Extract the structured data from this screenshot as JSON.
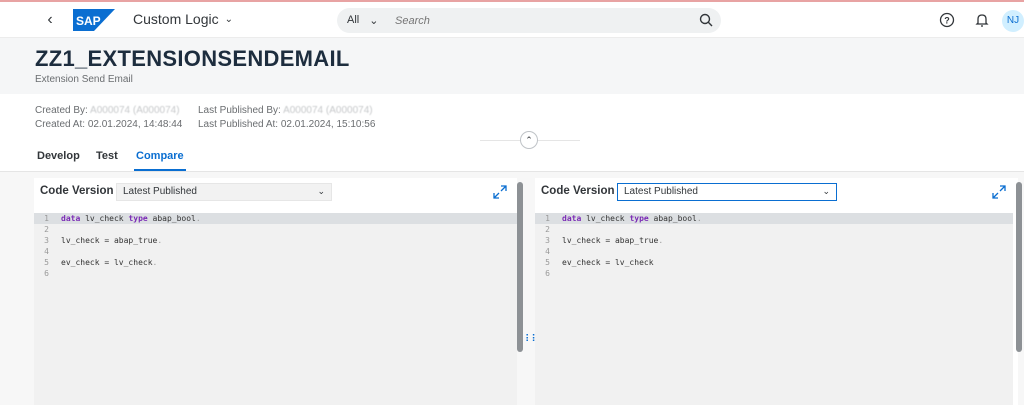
{
  "shell": {
    "app_title": "Custom Logic",
    "search_category": "All",
    "search_placeholder": "Search",
    "avatar_initials": "NJ",
    "brand": "SAP"
  },
  "object": {
    "title": "ZZ1_EXTENSIONSENDEMAIL",
    "subtitle": "Extension Send Email"
  },
  "meta": {
    "created_by_label": "Created By:",
    "created_by_value": "A000074 (A000074)",
    "created_at_label": "Created At:",
    "created_at_value": "02.01.2024, 14:48:44",
    "published_by_label": "Last Published By:",
    "published_by_value": "A000074 (A000074)",
    "published_at_label": "Last Published At:",
    "published_at_value": "02.01.2024, 15:10:56"
  },
  "tabs": {
    "develop": "Develop",
    "test": "Test",
    "compare": "Compare"
  },
  "left_panel": {
    "label": "Code Version",
    "selected": "Latest Published"
  },
  "right_panel": {
    "label": "Code Version",
    "selected": "Latest Published"
  },
  "code_lines": [
    {
      "n": "1",
      "kw1": "data",
      "text": " lv_check ",
      "kw2": "type",
      "text2": " abap_bool",
      "end": "."
    },
    {
      "n": "2",
      "text": ""
    },
    {
      "n": "3",
      "text": "lv_check = abap_true",
      "end": "."
    },
    {
      "n": "4",
      "text": ""
    },
    {
      "n": "5",
      "text": "ev_check = lv_check",
      "end": "."
    },
    {
      "n": "6",
      "text": ""
    }
  ],
  "colors": {
    "accent": "#0a6ed1",
    "keyword": "#7a2ab5",
    "header_bg": "#f5f6f7"
  }
}
